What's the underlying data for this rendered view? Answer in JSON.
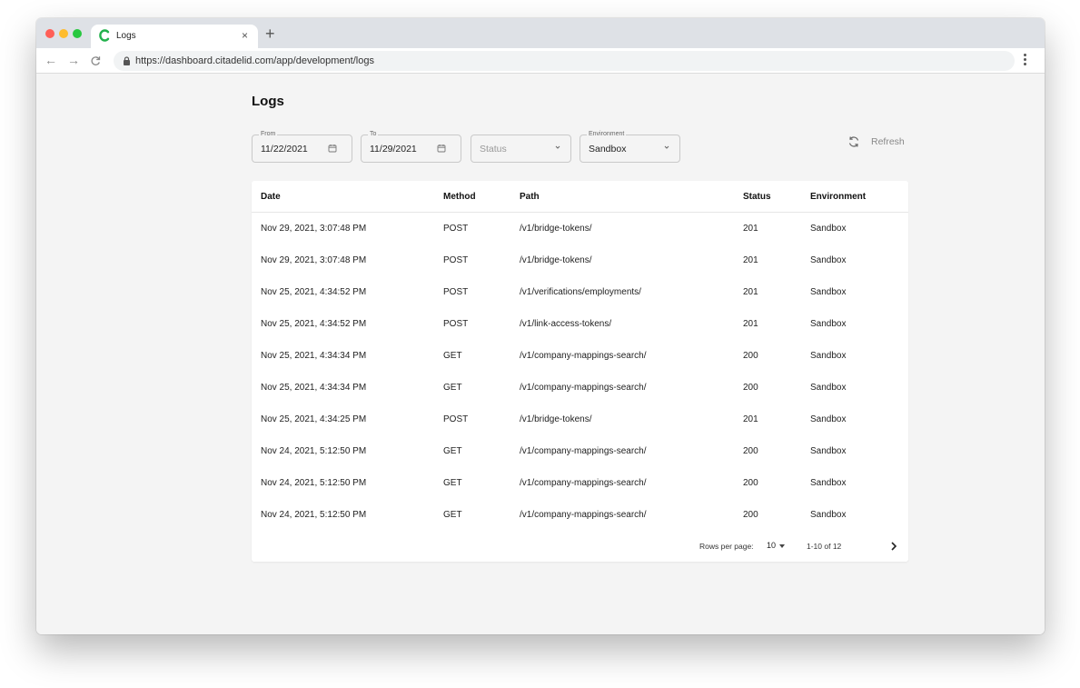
{
  "browser": {
    "tab_title": "Logs",
    "tab_close": "×",
    "new_tab": "+",
    "back": "←",
    "forward": "→",
    "reload": "C",
    "url": "https://dashboard.citadelid.com/app/development/logs",
    "favicon_color": "#22b14c"
  },
  "page": {
    "title": "Logs"
  },
  "filters": {
    "from": {
      "legend": "From",
      "value": "11/22/2021"
    },
    "to": {
      "legend": "To",
      "value": "11/29/2021"
    },
    "status": {
      "placeholder": "Status"
    },
    "environment": {
      "legend": "Environment",
      "value": "Sandbox"
    },
    "refresh_label": "Refresh"
  },
  "table": {
    "headers": {
      "date": "Date",
      "method": "Method",
      "path": "Path",
      "status": "Status",
      "environment": "Environment"
    },
    "rows": [
      {
        "date": "Nov 29, 2021, 3:07:48 PM",
        "method": "POST",
        "path": "/v1/bridge-tokens/",
        "status": "201",
        "environment": "Sandbox"
      },
      {
        "date": "Nov 29, 2021, 3:07:48 PM",
        "method": "POST",
        "path": "/v1/bridge-tokens/",
        "status": "201",
        "environment": "Sandbox"
      },
      {
        "date": "Nov 25, 2021, 4:34:52 PM",
        "method": "POST",
        "path": "/v1/verifications/employments/",
        "status": "201",
        "environment": "Sandbox"
      },
      {
        "date": "Nov 25, 2021, 4:34:52 PM",
        "method": "POST",
        "path": "/v1/link-access-tokens/",
        "status": "201",
        "environment": "Sandbox"
      },
      {
        "date": "Nov 25, 2021, 4:34:34 PM",
        "method": "GET",
        "path": "/v1/company-mappings-search/",
        "status": "200",
        "environment": "Sandbox"
      },
      {
        "date": "Nov 25, 2021, 4:34:34 PM",
        "method": "GET",
        "path": "/v1/company-mappings-search/",
        "status": "200",
        "environment": "Sandbox"
      },
      {
        "date": "Nov 25, 2021, 4:34:25 PM",
        "method": "POST",
        "path": "/v1/bridge-tokens/",
        "status": "201",
        "environment": "Sandbox"
      },
      {
        "date": "Nov 24, 2021, 5:12:50 PM",
        "method": "GET",
        "path": "/v1/company-mappings-search/",
        "status": "200",
        "environment": "Sandbox"
      },
      {
        "date": "Nov 24, 2021, 5:12:50 PM",
        "method": "GET",
        "path": "/v1/company-mappings-search/",
        "status": "200",
        "environment": "Sandbox"
      },
      {
        "date": "Nov 24, 2021, 5:12:50 PM",
        "method": "GET",
        "path": "/v1/company-mappings-search/",
        "status": "200",
        "environment": "Sandbox"
      }
    ]
  },
  "pagination": {
    "rows_per_page_label": "Rows per page:",
    "rows_per_page_value": "10",
    "range": "1-10 of 12"
  }
}
